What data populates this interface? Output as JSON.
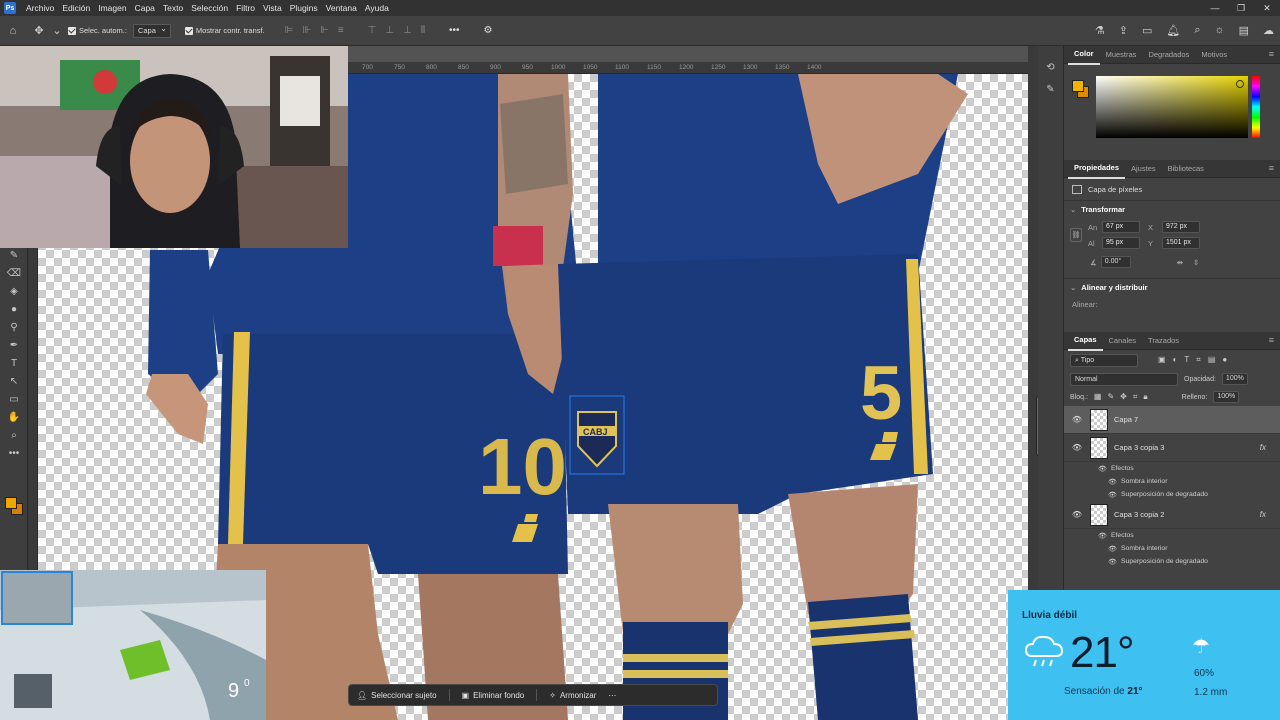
{
  "menubar": {
    "app_icon": "Ps",
    "items": [
      "Archivo",
      "Edición",
      "Imagen",
      "Capa",
      "Texto",
      "Selección",
      "Filtro",
      "Vista",
      "Plugins",
      "Ventana",
      "Ayuda"
    ]
  },
  "options": {
    "auto_select_label": "Selec. autom.:",
    "auto_select_target": "Capa",
    "show_transform_label": "Mostrar contr. transf."
  },
  "ruler": {
    "ticks": [
      "700",
      "750",
      "800",
      "850",
      "900",
      "950",
      "1000",
      "1050",
      "1100",
      "1150",
      "1200",
      "1250",
      "1300",
      "1350",
      "1400"
    ]
  },
  "canvas_selection": {
    "badge_text": "CABJ"
  },
  "context_bar": {
    "select_subject": "Seleccionar sujeto",
    "remove_bg": "Eliminar fondo",
    "harmonize": "Armonizar"
  },
  "color_panel": {
    "tabs": [
      "Color",
      "Muestras",
      "Degradados",
      "Motivos"
    ],
    "active_tab": "Color",
    "fg_color": "#f0b400",
    "bg_color": "#e08a00"
  },
  "properties": {
    "tabs": [
      "Propiedades",
      "Ajustes",
      "Bibliotecas"
    ],
    "layer_type": "Capa de píxeles",
    "transform_title": "Transformar",
    "width_label": "An",
    "width": "67 px",
    "x_label": "X",
    "x": "972 px",
    "height_label": "Al",
    "height": "95 px",
    "y_label": "Y",
    "y": "1501 px",
    "angle": "0.00°",
    "align_title": "Alinear y distribuir",
    "align_label": "Alinear:"
  },
  "layers": {
    "tabs": [
      "Capas",
      "Canales",
      "Trazados"
    ],
    "filter": "Tipo",
    "blend_mode": "Normal",
    "opacity_label": "Opacidad:",
    "opacity": "100%",
    "lock_label": "Bloq.:",
    "fill_label": "Relleno:",
    "fill": "100%",
    "items": [
      {
        "name": "Capa 7",
        "fx": ""
      },
      {
        "name": "Capa 3 copia 3",
        "fx": "fx",
        "effects_title": "Efectos",
        "effects": [
          "Sombra interior",
          "Superposición de degradado"
        ]
      },
      {
        "name": "Capa 3 copia 2",
        "fx": "fx",
        "effects_title": "Efectos",
        "effects": [
          "Sombra interior",
          "Superposición de degradado"
        ]
      }
    ]
  },
  "game_overlay": {
    "speed": "9",
    "unit": "0"
  },
  "weather": {
    "condition": "Lluvia débil",
    "temperature": "21°",
    "feels_like_label": "Sensación de",
    "feels_like": "21°",
    "precip_chance": "60%",
    "rain_amount": "1.2 mm"
  }
}
